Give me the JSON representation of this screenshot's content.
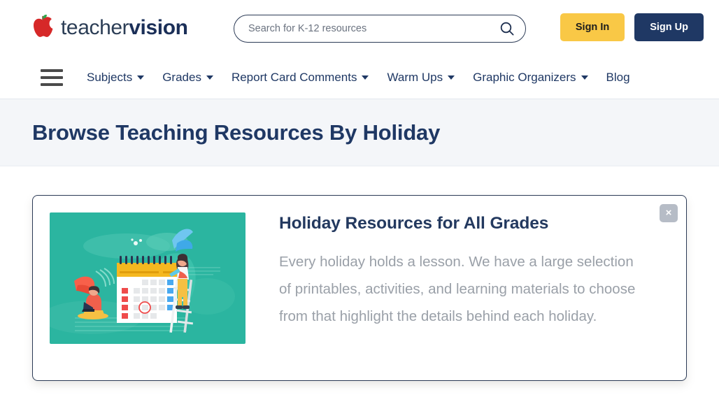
{
  "header": {
    "logo": {
      "icon": "apple-icon",
      "text_light": "teacher",
      "text_bold": "vision"
    },
    "search": {
      "placeholder": "Search for K-12 resources",
      "value": "",
      "icon": "search-icon"
    },
    "sign_in_label": "Sign In",
    "sign_up_label": "Sign Up",
    "colors": {
      "sign_in_bg": "#f9c846",
      "sign_up_bg": "#1f3864",
      "navy": "#1f3864"
    }
  },
  "nav": {
    "menu_icon": "hamburger-menu-icon",
    "items": [
      {
        "label": "Subjects",
        "has_dropdown": true
      },
      {
        "label": "Grades",
        "has_dropdown": true
      },
      {
        "label": "Report Card Comments",
        "has_dropdown": true
      },
      {
        "label": "Warm Ups",
        "has_dropdown": true
      },
      {
        "label": "Graphic Organizers",
        "has_dropdown": true
      },
      {
        "label": "Blog",
        "has_dropdown": false
      }
    ]
  },
  "page": {
    "title": "Browse Teaching Resources By Holiday",
    "title_band_bg": "#f4f6f9"
  },
  "card": {
    "title": "Holiday Resources for All Grades",
    "text": "Every holiday holds a lesson. We have a large selection of printables, activities, and learning materials to choose from that highlight the details behind each holiday.",
    "close_label": "×",
    "close_icon": "close-icon",
    "illustration": {
      "name": "holiday-calendar-illustration",
      "background": "#2bb5a0",
      "elements": [
        "calendar",
        "person-on-ladder",
        "person-with-laptop",
        "leaves",
        "ladder"
      ]
    }
  }
}
